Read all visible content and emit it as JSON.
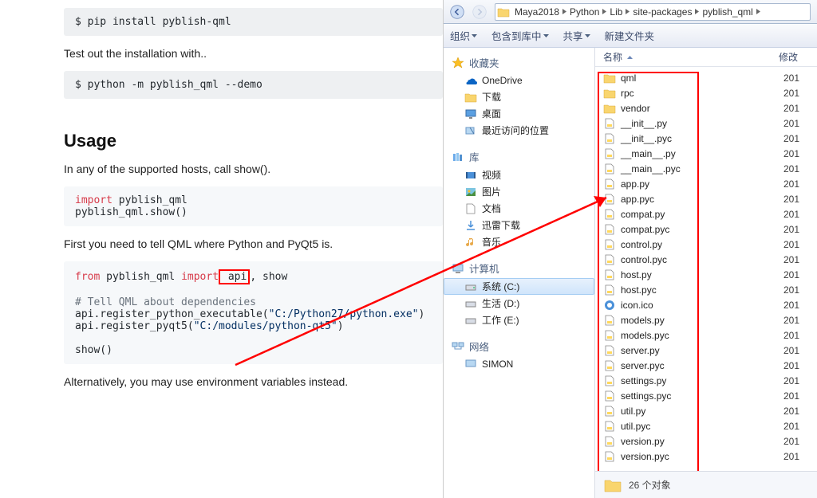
{
  "doc": {
    "cmd1": "$ pip install pyblish-qml",
    "text1": "Test out the installation with..",
    "cmd2": "$ python -m pyblish_qml --demo",
    "usage_h": "Usage",
    "text2": "In any of the supported hosts, call show().",
    "code1_l1a": "import",
    "code1_l1b": " pyblish_qml",
    "code1_l2": "pyblish_qml.show()",
    "text3": "First you need to tell QML where Python and PyQt5 is.",
    "code2_l1a": "from",
    "code2_l1b": " pyblish_qml ",
    "code2_l1c": "import",
    "code2_l1d": " api",
    "code2_l1e": ", show",
    "code2_l3": "# Tell QML about dependencies",
    "code2_l4a": "api.register_python_executable(",
    "code2_l4b": "\"C:/Python27/python.exe\"",
    "code2_l4c": ")",
    "code2_l5a": "api.register_pyqt5(",
    "code2_l5b": "\"C:/modules/python-qt5\"",
    "code2_l5c": ")",
    "code2_l7": "show()",
    "text4": "Alternatively, you may use environment variables instead."
  },
  "explorer": {
    "breadcrumb": [
      "Maya2018",
      "Python",
      "Lib",
      "site-packages",
      "pyblish_qml"
    ],
    "toolbar": {
      "organize": "组织",
      "include": "包含到库中",
      "share": "共享",
      "new_folder": "新建文件夹"
    },
    "tree": {
      "favorites": "收藏夹",
      "fav_items": [
        "OneDrive",
        "下载",
        "桌面",
        "最近访问的位置"
      ],
      "libraries": "库",
      "lib_items": [
        "视频",
        "图片",
        "文档",
        "迅雷下载",
        "音乐"
      ],
      "lib_last": "音乐",
      "computer": "计算机",
      "drives": [
        "系统 (C:)",
        "生活 (D:)",
        "工作 (E:)"
      ],
      "network": "网络",
      "net_items": [
        "SIMON"
      ]
    },
    "columns": {
      "name": "名称",
      "modified": "修改"
    },
    "files": [
      {
        "n": "qml",
        "t": "folder"
      },
      {
        "n": "rpc",
        "t": "folder"
      },
      {
        "n": "vendor",
        "t": "folder"
      },
      {
        "n": "__init__.py",
        "t": "py"
      },
      {
        "n": "__init__.pyc",
        "t": "pyc"
      },
      {
        "n": "__main__.py",
        "t": "py"
      },
      {
        "n": "__main__.pyc",
        "t": "pyc"
      },
      {
        "n": "app.py",
        "t": "py"
      },
      {
        "n": "app.pyc",
        "t": "pyc"
      },
      {
        "n": "compat.py",
        "t": "py"
      },
      {
        "n": "compat.pyc",
        "t": "pyc"
      },
      {
        "n": "control.py",
        "t": "py"
      },
      {
        "n": "control.pyc",
        "t": "pyc"
      },
      {
        "n": "host.py",
        "t": "py"
      },
      {
        "n": "host.pyc",
        "t": "pyc"
      },
      {
        "n": "icon.ico",
        "t": "ico"
      },
      {
        "n": "models.py",
        "t": "py"
      },
      {
        "n": "models.pyc",
        "t": "pyc"
      },
      {
        "n": "server.py",
        "t": "py"
      },
      {
        "n": "server.pyc",
        "t": "pyc"
      },
      {
        "n": "settings.py",
        "t": "py"
      },
      {
        "n": "settings.pyc",
        "t": "pyc"
      },
      {
        "n": "util.py",
        "t": "py"
      },
      {
        "n": "util.pyc",
        "t": "pyc"
      },
      {
        "n": "version.py",
        "t": "py"
      },
      {
        "n": "version.pyc",
        "t": "pyc"
      }
    ],
    "date_prefix": "201",
    "status": "26 个对象"
  }
}
